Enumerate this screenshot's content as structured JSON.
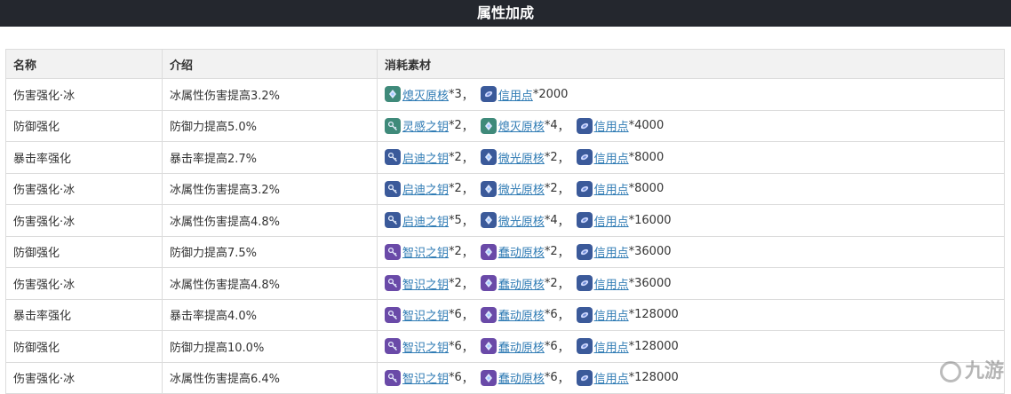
{
  "header": {
    "title": "属性加成"
  },
  "table": {
    "columns": [
      "名称",
      "介绍",
      "消耗素材"
    ],
    "rows": [
      {
        "name": "伤害强化·冰",
        "desc": "冰属性伤害提高3.2%",
        "mats": [
          {
            "icon": "core-icon",
            "color": "#3f8a7a",
            "name": "熄灭原核",
            "qty": "*3"
          },
          {
            "icon": "credit-icon",
            "color": "#3b5a9a",
            "name": "信用点",
            "qty": "*2000"
          }
        ]
      },
      {
        "name": "防御强化",
        "desc": "防御力提高5.0%",
        "mats": [
          {
            "icon": "key-icon",
            "color": "#3f8a7a",
            "name": "灵感之钥",
            "qty": "*2"
          },
          {
            "icon": "core-icon",
            "color": "#3f8a7a",
            "name": "熄灭原核",
            "qty": "*4"
          },
          {
            "icon": "credit-icon",
            "color": "#3b5a9a",
            "name": "信用点",
            "qty": "*4000"
          }
        ]
      },
      {
        "name": "暴击率强化",
        "desc": "暴击率提高2.7%",
        "mats": [
          {
            "icon": "key-icon",
            "color": "#3b5a9a",
            "name": "启迪之钥",
            "qty": "*2"
          },
          {
            "icon": "core-icon",
            "color": "#3b5a9a",
            "name": "微光原核",
            "qty": "*2"
          },
          {
            "icon": "credit-icon",
            "color": "#3b5a9a",
            "name": "信用点",
            "qty": "*8000"
          }
        ]
      },
      {
        "name": "伤害强化·冰",
        "desc": "冰属性伤害提高3.2%",
        "mats": [
          {
            "icon": "key-icon",
            "color": "#3b5a9a",
            "name": "启迪之钥",
            "qty": "*2"
          },
          {
            "icon": "core-icon",
            "color": "#3b5a9a",
            "name": "微光原核",
            "qty": "*2"
          },
          {
            "icon": "credit-icon",
            "color": "#3b5a9a",
            "name": "信用点",
            "qty": "*8000"
          }
        ]
      },
      {
        "name": "伤害强化·冰",
        "desc": "冰属性伤害提高4.8%",
        "mats": [
          {
            "icon": "key-icon",
            "color": "#3b5a9a",
            "name": "启迪之钥",
            "qty": "*5"
          },
          {
            "icon": "core-icon",
            "color": "#3b5a9a",
            "name": "微光原核",
            "qty": "*4"
          },
          {
            "icon": "credit-icon",
            "color": "#3b5a9a",
            "name": "信用点",
            "qty": "*16000"
          }
        ]
      },
      {
        "name": "防御强化",
        "desc": "防御力提高7.5%",
        "mats": [
          {
            "icon": "key-icon",
            "color": "#6a4aa8",
            "name": "智识之钥",
            "qty": "*2"
          },
          {
            "icon": "core-icon",
            "color": "#6a4aa8",
            "name": "蠢动原核",
            "qty": "*2"
          },
          {
            "icon": "credit-icon",
            "color": "#3b5a9a",
            "name": "信用点",
            "qty": "*36000"
          }
        ]
      },
      {
        "name": "伤害强化·冰",
        "desc": "冰属性伤害提高4.8%",
        "mats": [
          {
            "icon": "key-icon",
            "color": "#6a4aa8",
            "name": "智识之钥",
            "qty": "*2"
          },
          {
            "icon": "core-icon",
            "color": "#6a4aa8",
            "name": "蠢动原核",
            "qty": "*2"
          },
          {
            "icon": "credit-icon",
            "color": "#3b5a9a",
            "name": "信用点",
            "qty": "*36000"
          }
        ]
      },
      {
        "name": "暴击率强化",
        "desc": "暴击率提高4.0%",
        "mats": [
          {
            "icon": "key-icon",
            "color": "#6a4aa8",
            "name": "智识之钥",
            "qty": "*6"
          },
          {
            "icon": "core-icon",
            "color": "#6a4aa8",
            "name": "蠢动原核",
            "qty": "*6"
          },
          {
            "icon": "credit-icon",
            "color": "#3b5a9a",
            "name": "信用点",
            "qty": "*128000"
          }
        ]
      },
      {
        "name": "防御强化",
        "desc": "防御力提高10.0%",
        "mats": [
          {
            "icon": "key-icon",
            "color": "#6a4aa8",
            "name": "智识之钥",
            "qty": "*6"
          },
          {
            "icon": "core-icon",
            "color": "#6a4aa8",
            "name": "蠢动原核",
            "qty": "*6"
          },
          {
            "icon": "credit-icon",
            "color": "#3b5a9a",
            "name": "信用点",
            "qty": "*128000"
          }
        ]
      },
      {
        "name": "伤害强化·冰",
        "desc": "冰属性伤害提高6.4%",
        "mats": [
          {
            "icon": "key-icon",
            "color": "#6a4aa8",
            "name": "智识之钥",
            "qty": "*6"
          },
          {
            "icon": "core-icon",
            "color": "#6a4aa8",
            "name": "蠢动原核",
            "qty": "*6"
          },
          {
            "icon": "credit-icon",
            "color": "#3b5a9a",
            "name": "信用点",
            "qty": "*128000"
          }
        ]
      }
    ]
  },
  "watermark": {
    "text": "九游"
  }
}
